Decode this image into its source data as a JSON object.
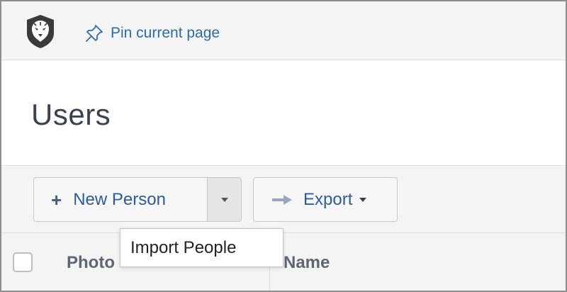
{
  "topbar": {
    "logo_icon": "lion-head-icon",
    "pin_label": "Pin current page",
    "pin_icon": "pushpin-icon"
  },
  "page": {
    "title": "Users"
  },
  "toolbar": {
    "new_person_label": "New Person",
    "new_person_icon": "plus-icon",
    "split_caret_icon": "caret-down-icon",
    "export_label": "Export",
    "export_icon": "arrow-right-icon"
  },
  "dropdown": {
    "items": [
      {
        "label": "Import People"
      }
    ]
  },
  "table": {
    "columns": [
      {
        "label": "Photo"
      },
      {
        "label": "Name"
      }
    ]
  },
  "colors": {
    "accent": "#2b6cb0",
    "title": "#3a4150",
    "bar_background": "#f4f4f4"
  }
}
